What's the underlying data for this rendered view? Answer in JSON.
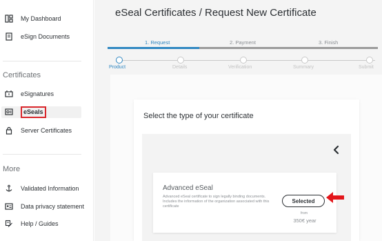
{
  "sidebar": {
    "items": [
      {
        "label": "My Dashboard",
        "icon": "dashboard-icon"
      },
      {
        "label": "eSign Documents",
        "icon": "document-icon"
      }
    ],
    "certificates_heading": "Certificates",
    "certificates_items": [
      {
        "label": "eSignatures",
        "icon": "signature-icon"
      },
      {
        "label": "eSeals",
        "icon": "seal-icon",
        "active": true
      },
      {
        "label": "Server Certificates",
        "icon": "lock-icon"
      }
    ],
    "more_heading": "More",
    "more_items": [
      {
        "label": "Validated Information",
        "icon": "anchor-icon"
      },
      {
        "label": "Data privacy statement",
        "icon": "privacy-icon"
      },
      {
        "label": "Help / Guides",
        "icon": "help-icon"
      }
    ]
  },
  "main": {
    "title": "eSeal Certificates / Request New Certificate",
    "steps": [
      {
        "label": "1. Request",
        "active": true
      },
      {
        "label": "2. Payment",
        "active": false
      },
      {
        "label": "3. Finish",
        "active": false
      }
    ],
    "progress_fraction": 0.34,
    "substeps": [
      {
        "label": "Product",
        "active": true
      },
      {
        "label": "Details",
        "active": false
      },
      {
        "label": "Verification",
        "active": false
      },
      {
        "label": "Summary",
        "active": false
      },
      {
        "label": "Submit",
        "active": false
      }
    ],
    "card_title": "Select the type of your certificate",
    "option": {
      "title": "Advanced eSeal",
      "description": "Advanced eSeal certificate to sign legally binding documents. Includes the information of the organization associated with this certificate",
      "button_label": "Selected",
      "from_label": "from",
      "price": "350€ year"
    }
  },
  "colors": {
    "accent": "#2e86c1",
    "highlight": "#d9262b",
    "arrow": "#e3161b"
  }
}
